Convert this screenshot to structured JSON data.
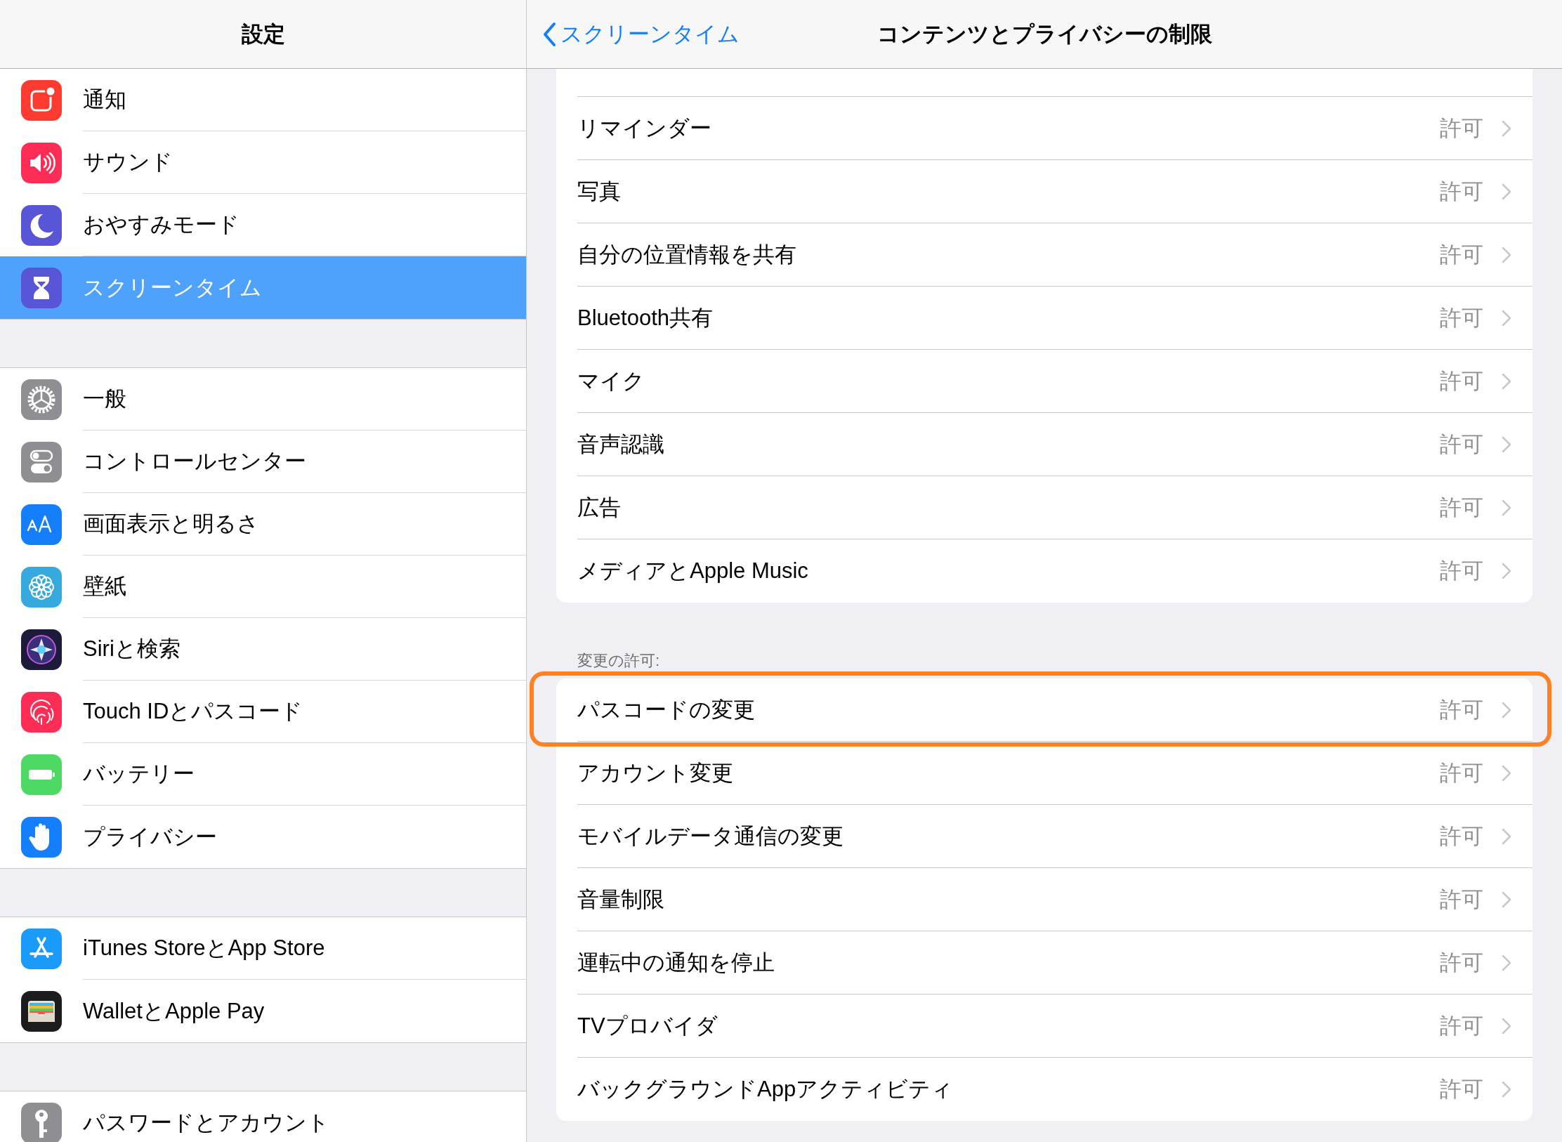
{
  "sidebar": {
    "title": "設定",
    "groups": [
      {
        "items": [
          {
            "label": "通知",
            "kind": "notification",
            "color": "#fe3b30",
            "selected": false
          },
          {
            "label": "サウンド",
            "kind": "sound",
            "color": "#fe2d55",
            "selected": false
          },
          {
            "label": "おやすみモード",
            "kind": "moon",
            "color": "#5856d6",
            "selected": false
          },
          {
            "label": "スクリーンタイム",
            "kind": "hourglass",
            "color": "#5856d6",
            "selected": true
          }
        ]
      },
      {
        "items": [
          {
            "label": "一般",
            "kind": "gear",
            "color": "#8e8e93",
            "selected": false
          },
          {
            "label": "コントロールセンター",
            "kind": "toggles",
            "color": "#8e8e93",
            "selected": false
          },
          {
            "label": "画面表示と明るさ",
            "kind": "textsize",
            "color": "#147efb",
            "selected": false
          },
          {
            "label": "壁紙",
            "kind": "flower",
            "color": "#36aadc",
            "selected": false
          },
          {
            "label": "Siriと検索",
            "kind": "orb",
            "color": "#1d1b3c",
            "selected": false
          },
          {
            "label": "Touch IDとパスコード",
            "kind": "fingerprint",
            "color": "#fe2d55",
            "selected": false
          },
          {
            "label": "バッテリー",
            "kind": "battery",
            "color": "#4cd964",
            "selected": false
          },
          {
            "label": "プライバシー",
            "kind": "hand",
            "color": "#147efb",
            "selected": false
          }
        ]
      },
      {
        "items": [
          {
            "label": "iTunes StoreとApp Store",
            "kind": "appstore",
            "color": "#1a9bf9",
            "selected": false
          },
          {
            "label": "WalletとApple Pay",
            "kind": "wallet",
            "color": "#1c1c1e",
            "selected": false
          }
        ]
      },
      {
        "items": [
          {
            "label": "パスワードとアカウント",
            "kind": "key",
            "color": "#8e8e93",
            "selected": false
          }
        ]
      }
    ]
  },
  "detail": {
    "back_button": "スクリーンタイム",
    "title": "コンテンツとプライバシーの制限",
    "sections": [
      {
        "rows": [
          {
            "label": "リマインダー",
            "value": "許可",
            "highlighted": false
          },
          {
            "label": "写真",
            "value": "許可",
            "highlighted": false
          },
          {
            "label": "自分の位置情報を共有",
            "value": "許可",
            "highlighted": false
          },
          {
            "label": "Bluetooth共有",
            "value": "許可",
            "highlighted": false
          },
          {
            "label": "マイク",
            "value": "許可",
            "highlighted": false
          },
          {
            "label": "音声認識",
            "value": "許可",
            "highlighted": false
          },
          {
            "label": "広告",
            "value": "許可",
            "highlighted": false
          },
          {
            "label": "メディアとApple Music",
            "value": "許可",
            "highlighted": false
          }
        ]
      },
      {
        "header": "変更の許可:",
        "rows": [
          {
            "label": "パスコードの変更",
            "value": "許可",
            "highlighted": true
          },
          {
            "label": "アカウント変更",
            "value": "許可",
            "highlighted": false
          },
          {
            "label": "モバイルデータ通信の変更",
            "value": "許可",
            "highlighted": false
          },
          {
            "label": "音量制限",
            "value": "許可",
            "highlighted": false
          },
          {
            "label": "運転中の通知を停止",
            "value": "許可",
            "highlighted": false
          },
          {
            "label": "TVプロバイダ",
            "value": "許可",
            "highlighted": false
          },
          {
            "label": "バックグラウンドAppアクティビティ",
            "value": "許可",
            "highlighted": false
          }
        ]
      }
    ]
  }
}
